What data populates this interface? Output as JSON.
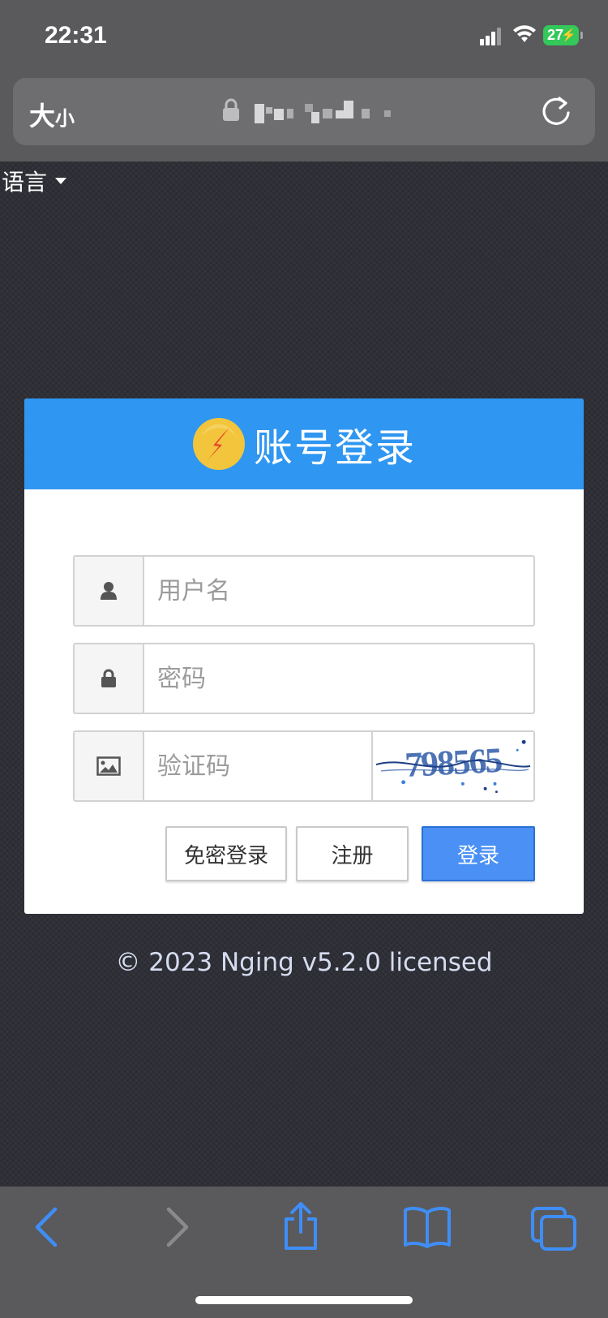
{
  "status_bar": {
    "time": "22:31",
    "battery": "27"
  },
  "address_bar": {
    "text_size_label_big": "大",
    "text_size_label_small": "小",
    "url": "",
    "icons": [
      "lock-icon",
      "reload-icon"
    ]
  },
  "language": {
    "label": "语言"
  },
  "login": {
    "title": "账号登录",
    "username_placeholder": "用户名",
    "password_placeholder": "密码",
    "captcha_placeholder": "验证码",
    "captcha_code": "798565",
    "passwordless_button": "免密登录",
    "register_button": "注册",
    "login_button": "登录"
  },
  "footer": {
    "copyright": "© 2023 Nging v5.2.0 licensed"
  },
  "colors": {
    "header_blue": "#2f96f1",
    "primary_button": "#4a90f5",
    "page_background": "#2f3037",
    "ios_blue": "#3f8ef7"
  }
}
